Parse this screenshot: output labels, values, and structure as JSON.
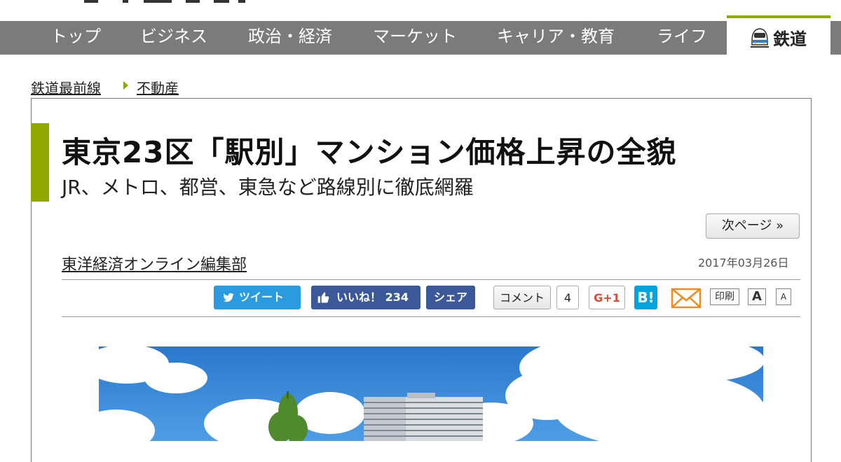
{
  "nav": {
    "items": [
      "トップ",
      "ビジネス",
      "政治・経済",
      "マーケット",
      "キャリア・教育",
      "ライフ"
    ],
    "active": "鉄道",
    "accent_color": "#8ea800",
    "active_icon": "train-icon"
  },
  "breadcrumb": {
    "items": [
      "鉄道最前線",
      "不動産"
    ]
  },
  "article": {
    "title": "東京23区「駅別」マンション価格上昇の全貌",
    "subtitle": "JR、メトロ、都営、東急など路線別に徹底網羅",
    "next_page": "次ページ »",
    "author": "東洋経済オンライン編集部",
    "date": "2017年03月26日"
  },
  "share": {
    "tweet": "ツイート",
    "like": "いいね！ 234",
    "fb_share": "シェア",
    "comment": "コメント",
    "comment_count": "4",
    "gplus": "G+1",
    "hatena": "B!",
    "print": "印刷",
    "font_large": "A",
    "font_small": "A",
    "icons": [
      "twitter-bird-icon",
      "facebook-thumb-icon",
      "mail-icon"
    ]
  }
}
